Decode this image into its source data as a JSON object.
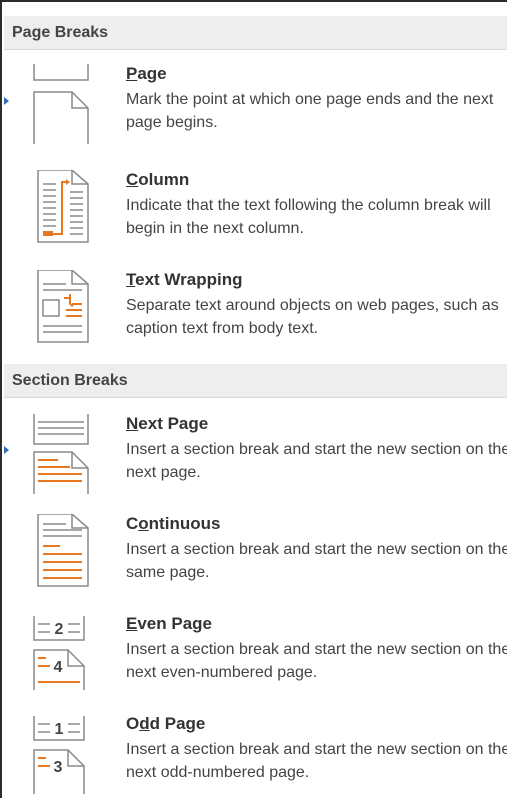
{
  "sections": [
    {
      "header": "Page Breaks",
      "items": [
        {
          "key": "page",
          "accel": "P",
          "title_rest": "age",
          "desc": "Mark the point at which one page ends and the next page begins.",
          "icon": "page-break-icon"
        },
        {
          "key": "column",
          "accel": "C",
          "title_rest": "olumn",
          "desc": "Indicate that the text following the column break will begin in the next column.",
          "icon": "column-break-icon"
        },
        {
          "key": "text-wrapping",
          "accel": "T",
          "title_rest": "ext Wrapping",
          "desc": "Separate text around objects on web pages, such as caption text from body text.",
          "icon": "text-wrapping-break-icon"
        }
      ]
    },
    {
      "header": "Section Breaks",
      "items": [
        {
          "key": "next-page",
          "accel": "N",
          "title_rest": "ext Page",
          "desc": "Insert a section break and start the new section on the next page.",
          "icon": "next-page-section-break-icon"
        },
        {
          "key": "continuous",
          "accel_prefix": "C",
          "accel": "o",
          "title_rest": "ntinuous",
          "desc": "Insert a section break and start the new section on the same page.",
          "icon": "continuous-section-break-icon"
        },
        {
          "key": "even-page",
          "accel": "E",
          "title_rest": "ven Page",
          "desc": "Insert a section break and start the new section on the next even-numbered page.",
          "icon": "even-page-section-break-icon",
          "num_top": "2",
          "num_bottom": "4"
        },
        {
          "key": "odd-page",
          "accel_prefix": "O",
          "accel": "d",
          "title_rest": "d Page",
          "desc": "Insert a section break and start the new section on the next odd-numbered page.",
          "icon": "odd-page-section-break-icon",
          "num_top": "1",
          "num_bottom": "3"
        }
      ]
    }
  ],
  "colors": {
    "accent": "#e8781f",
    "marker": "#2f6fb8",
    "header_bg": "#eeeeee",
    "line": "#8a8a8a"
  }
}
